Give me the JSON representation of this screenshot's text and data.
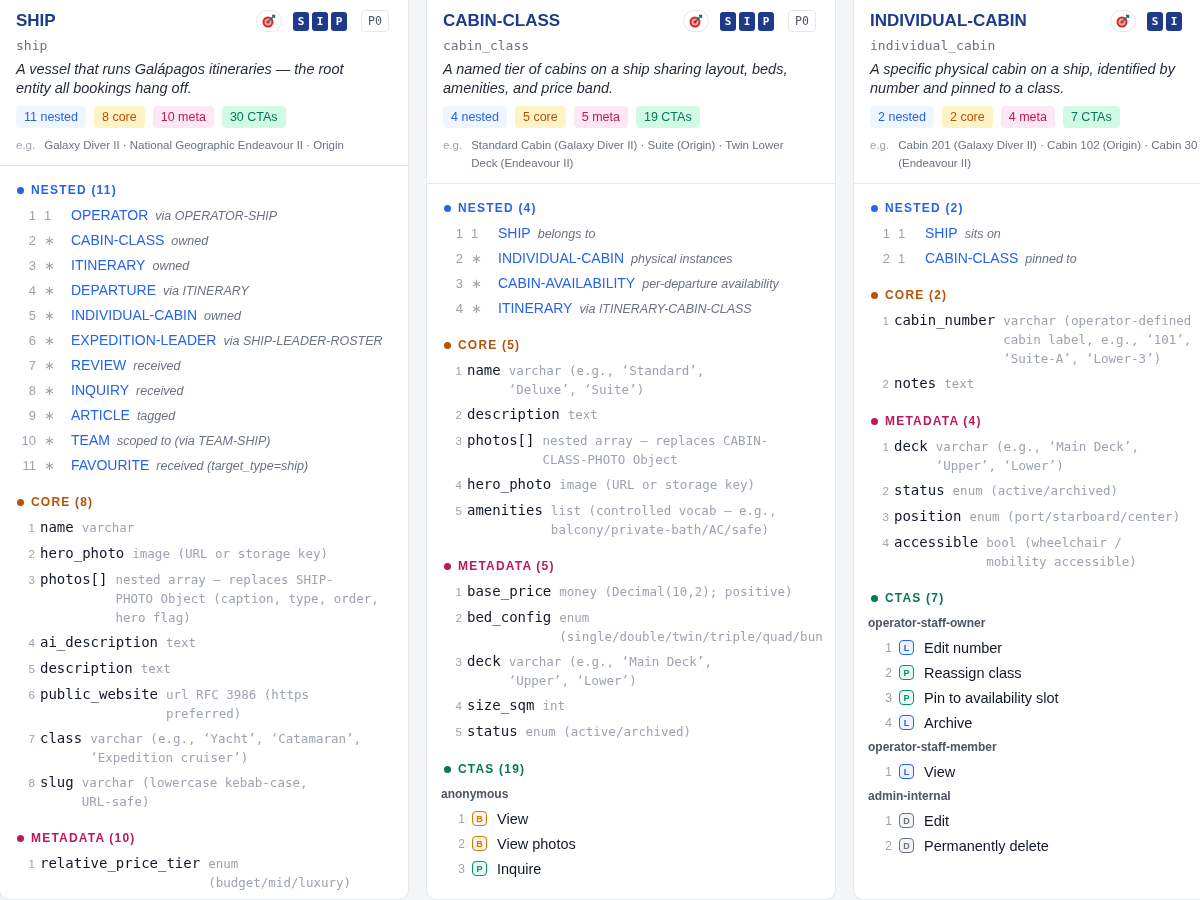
{
  "cards": [
    {
      "title": "SHIP",
      "code": "ship",
      "letter_badges": [
        "S",
        "I",
        "P"
      ],
      "priority": "P0",
      "description": "A vessel that runs Galápagos itineraries — the root\nentity all bookings hang off.",
      "chips": [
        {
          "kind": "nested",
          "label": "11 nested"
        },
        {
          "kind": "core",
          "label": "8 core"
        },
        {
          "kind": "metadata",
          "label": "10 meta"
        },
        {
          "kind": "ctas",
          "label": "30 CTAs"
        }
      ],
      "example_label": "e.g.",
      "examples": "Galaxy Diver II · National Geographic Endeavour II · Origin",
      "sections": [
        {
          "kind": "nested",
          "heading": "NESTED (11)",
          "rows": [
            {
              "num": "1",
              "cardinality": "1",
              "name": "OPERATOR",
              "relation": "via OPERATOR-SHIP"
            },
            {
              "num": "2",
              "cardinality": "∗",
              "name": "CABIN-CLASS",
              "relation": "owned"
            },
            {
              "num": "3",
              "cardinality": "∗",
              "name": "ITINERARY",
              "relation": "owned"
            },
            {
              "num": "4",
              "cardinality": "∗",
              "name": "DEPARTURE",
              "relation": "via ITINERARY"
            },
            {
              "num": "5",
              "cardinality": "∗",
              "name": "INDIVIDUAL-CABIN",
              "relation": "owned"
            },
            {
              "num": "6",
              "cardinality": "∗",
              "name": "EXPEDITION-LEADER",
              "relation": "via SHIP-LEADER-ROSTER"
            },
            {
              "num": "7",
              "cardinality": "∗",
              "name": "REVIEW",
              "relation": "received"
            },
            {
              "num": "8",
              "cardinality": "∗",
              "name": "INQUIRY",
              "relation": "received"
            },
            {
              "num": "9",
              "cardinality": "∗",
              "name": "ARTICLE",
              "relation": "tagged"
            },
            {
              "num": "10",
              "cardinality": "∗",
              "name": "TEAM",
              "relation": "scoped to (via TEAM-SHIP)"
            },
            {
              "num": "11",
              "cardinality": "∗",
              "name": "FAVOURITE",
              "relation": "received (target_type=ship)"
            }
          ]
        },
        {
          "kind": "core",
          "heading": "CORE (8)",
          "rows": [
            {
              "num": "1",
              "name": "name",
              "type": "varchar"
            },
            {
              "num": "2",
              "name": "hero_photo",
              "type": "image (URL or storage key)"
            },
            {
              "num": "3",
              "name": "photos[]",
              "type": "nested array — replaces SHIP-\nPHOTO Object (caption, type, order,\nhero flag)"
            },
            {
              "num": "4",
              "name": "ai_description",
              "type": "text"
            },
            {
              "num": "5",
              "name": "description",
              "type": "text"
            },
            {
              "num": "6",
              "name": "public_website",
              "type": "url RFC 3986 (https\npreferred)"
            },
            {
              "num": "7",
              "name": "class",
              "type": "varchar (e.g., ‘Yacht’, ‘Catamaran’,\n‘Expedition cruiser’)"
            },
            {
              "num": "8",
              "name": "slug",
              "type": "varchar (lowercase kebab-case,\nURL-safe)"
            }
          ]
        },
        {
          "kind": "metadata",
          "heading": "METADATA (10)",
          "rows": [
            {
              "num": "1",
              "name": "relative_price_tier",
              "type": "enum\n(budget/mid/luxury)"
            }
          ]
        }
      ]
    },
    {
      "title": "CABIN-CLASS",
      "code": "cabin_class",
      "letter_badges": [
        "S",
        "I",
        "P"
      ],
      "priority": "P0",
      "description": "A named tier of cabins on a ship sharing layout, beds,\namenities, and price band.",
      "chips": [
        {
          "kind": "nested",
          "label": "4 nested"
        },
        {
          "kind": "core",
          "label": "5 core"
        },
        {
          "kind": "metadata",
          "label": "5 meta"
        },
        {
          "kind": "ctas",
          "label": "19 CTAs"
        }
      ],
      "example_label": "e.g.",
      "examples": "Standard Cabin (Galaxy Diver II) · Suite (Origin) · Twin Lower\nDeck (Endeavour II)",
      "sections": [
        {
          "kind": "nested",
          "heading": "NESTED (4)",
          "rows": [
            {
              "num": "1",
              "cardinality": "1",
              "name": "SHIP",
              "relation": "belongs to"
            },
            {
              "num": "2",
              "cardinality": "∗",
              "name": "INDIVIDUAL-CABIN",
              "relation": "physical instances"
            },
            {
              "num": "3",
              "cardinality": "∗",
              "name": "CABIN-AVAILABILITY",
              "relation": "per-departure availability"
            },
            {
              "num": "4",
              "cardinality": "∗",
              "name": "ITINERARY",
              "relation": "via ITINERARY-CABIN-CLASS"
            }
          ]
        },
        {
          "kind": "core",
          "heading": "CORE (5)",
          "rows": [
            {
              "num": "1",
              "name": "name",
              "type": "varchar (e.g., ‘Standard’,\n‘Deluxe’, ‘Suite’)"
            },
            {
              "num": "2",
              "name": "description",
              "type": "text"
            },
            {
              "num": "3",
              "name": "photos[]",
              "type": "nested array — replaces CABIN-\nCLASS-PHOTO Object"
            },
            {
              "num": "4",
              "name": "hero_photo",
              "type": "image (URL or storage key)"
            },
            {
              "num": "5",
              "name": "amenities",
              "type": "list (controlled vocab — e.g.,\nbalcony/private-bath/AC/safe)"
            }
          ]
        },
        {
          "kind": "metadata",
          "heading": "METADATA (5)",
          "rows": [
            {
              "num": "1",
              "name": "base_price",
              "type": "money (Decimal(10,2); positive)"
            },
            {
              "num": "2",
              "name": "bed_config",
              "type": "enum\n(single/double/twin/triple/quad/bun"
            },
            {
              "num": "3",
              "name": "deck",
              "type": "varchar (e.g., ‘Main Deck’,\n‘Upper’, ‘Lower’)"
            },
            {
              "num": "4",
              "name": "size_sqm",
              "type": "int"
            },
            {
              "num": "5",
              "name": "status",
              "type": "enum (active/archived)"
            }
          ]
        },
        {
          "kind": "ctas",
          "heading": "CTAS (19)",
          "groups": [
            {
              "role": "anonymous",
              "rows": [
                {
                  "num": "1",
                  "badge": "B",
                  "color": "#d97706",
                  "label": "View"
                },
                {
                  "num": "2",
                  "badge": "B",
                  "color": "#d97706",
                  "label": "View photos"
                },
                {
                  "num": "3",
                  "badge": "P",
                  "color": "#059669",
                  "label": "Inquire"
                }
              ]
            }
          ]
        }
      ]
    },
    {
      "title": "INDIVIDUAL-CABIN",
      "code": "individual_cabin",
      "letter_badges": [
        "S",
        "I"
      ],
      "description": "A specific physical cabin on a ship, identified by\nnumber and pinned to a class.",
      "chips": [
        {
          "kind": "nested",
          "label": "2 nested"
        },
        {
          "kind": "core",
          "label": "2 core"
        },
        {
          "kind": "metadata",
          "label": "4 meta"
        },
        {
          "kind": "ctas",
          "label": "7 CTAs"
        }
      ],
      "example_label": "e.g.",
      "examples": "Cabin 201 (Galaxy Diver II) · Cabin 102 (Origin) · Cabin 30\n(Endeavour II)",
      "sections": [
        {
          "kind": "nested",
          "heading": "NESTED (2)",
          "rows": [
            {
              "num": "1",
              "cardinality": "1",
              "name": "SHIP",
              "relation": "sits on"
            },
            {
              "num": "2",
              "cardinality": "1",
              "name": "CABIN-CLASS",
              "relation": "pinned to"
            }
          ]
        },
        {
          "kind": "core",
          "heading": "CORE (2)",
          "rows": [
            {
              "num": "1",
              "name": "cabin_number",
              "type": "varchar (operator-defined\ncabin label, e.g., ‘101’,\n‘Suite-A’, ‘Lower-3’)"
            },
            {
              "num": "2",
              "name": "notes",
              "type": "text"
            }
          ]
        },
        {
          "kind": "metadata",
          "heading": "METADATA (4)",
          "rows": [
            {
              "num": "1",
              "name": "deck",
              "type": "varchar (e.g., ‘Main Deck’,\n‘Upper’, ‘Lower’)"
            },
            {
              "num": "2",
              "name": "status",
              "type": "enum (active/archived)"
            },
            {
              "num": "3",
              "name": "position",
              "type": "enum (port/starboard/center)"
            },
            {
              "num": "4",
              "name": "accessible",
              "type": "bool (wheelchair /\nmobility accessible)"
            }
          ]
        },
        {
          "kind": "ctas",
          "heading": "CTAS (7)",
          "groups": [
            {
              "role": "operator-staff-owner",
              "rows": [
                {
                  "num": "1",
                  "badge": "L",
                  "color": "#2563eb",
                  "label": "Edit number"
                },
                {
                  "num": "2",
                  "badge": "P",
                  "color": "#059669",
                  "label": "Reassign class"
                },
                {
                  "num": "3",
                  "badge": "P",
                  "color": "#059669",
                  "label": "Pin to availability slot"
                },
                {
                  "num": "4",
                  "badge": "L",
                  "color": "#2563eb",
                  "label": "Archive"
                }
              ]
            },
            {
              "role": "operator-staff-member",
              "rows": [
                {
                  "num": "1",
                  "badge": "L",
                  "color": "#2563eb",
                  "label": "View"
                }
              ]
            },
            {
              "role": "admin-internal",
              "rows": [
                {
                  "num": "1",
                  "badge": "D",
                  "color": "#6b7280",
                  "label": "Edit"
                },
                {
                  "num": "2",
                  "badge": "D",
                  "color": "#6b7280",
                  "label": "Permanently delete"
                }
              ]
            }
          ]
        }
      ]
    }
  ]
}
